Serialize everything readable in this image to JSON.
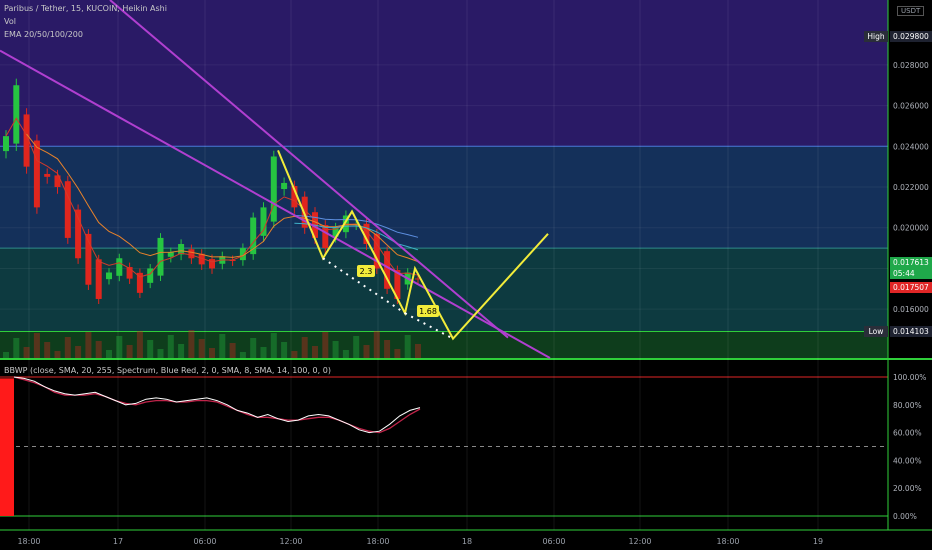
{
  "header": {
    "title": "Paribus / Tether, 15, KUCOIN, Heikin Ashi",
    "vol_label": "Vol",
    "ema_label": "EMA 20/50/100/200",
    "indicator_label": "BBWP (close, SMA, 20, 255, Spectrum, Blue Red, 2, 0, SMA, 8, SMA, 14, 100, 0, 0)"
  },
  "currency": "USDT",
  "high": {
    "label": "High",
    "value": "0.029800"
  },
  "low": {
    "label": "Low",
    "value": "0.014103"
  },
  "price_tags": {
    "last": "0.017613",
    "countdown": "05:44",
    "bid": "0.017507"
  },
  "pattern_labels": {
    "a": "2.3",
    "b": "1.68"
  },
  "colors": {
    "bull": "#26c441",
    "bear": "#e0261e",
    "trendline": "#b03fd0",
    "projection": "#f2ec3a",
    "ema_red": "#d23a2a",
    "ema_orange": "#e8822a",
    "ema_teal": "#3fb0c8",
    "ema_blue": "#5d8fe0",
    "bbwp": "#ffffff",
    "bbwp_ma": "#c0244a",
    "zone_purple": "#2a1a66",
    "zone_blue": "#14305a",
    "zone_teal": "#0d3a40",
    "zone_green": "#0e3d1c"
  },
  "chart_data": [
    {
      "type": "candlestick",
      "title": "Paribus / Tether, 15, KUCOIN, Heikin Ashi",
      "y_ticks": [
        "0.028000",
        "0.026000",
        "0.024000",
        "0.022000",
        "0.020000",
        "0.018000",
        "0.016000"
      ],
      "ylim": [
        0.0136,
        0.0305
      ],
      "x_ticks": [
        "18:00",
        "17",
        "06:00",
        "12:00",
        "18:00",
        "18",
        "06:00",
        "12:00",
        "18:00",
        "19"
      ],
      "high": 0.0298,
      "low": 0.014103,
      "last": 0.017613,
      "bid": 0.017507,
      "series_close": [
        0.0245,
        0.027,
        0.023,
        0.021,
        0.0225,
        0.022,
        0.0195,
        0.0185,
        0.0172,
        0.0165,
        0.0178,
        0.0185,
        0.0175,
        0.0168,
        0.018,
        0.0195,
        0.0188,
        0.0192,
        0.0185,
        0.0182,
        0.018,
        0.0186,
        0.0184,
        0.019,
        0.0205,
        0.021,
        0.0235,
        0.0222,
        0.021,
        0.02,
        0.0195,
        0.019,
        0.02,
        0.0206,
        0.0202,
        0.0192,
        0.018,
        0.017,
        0.0165,
        0.0178,
        0.0175
      ],
      "zones": [
        {
          "from": 0.024,
          "to": 0.0305,
          "color": "purple"
        },
        {
          "from": 0.019,
          "to": 0.024,
          "color": "blue"
        },
        {
          "from": 0.0149,
          "to": 0.019,
          "color": "teal"
        },
        {
          "from": 0.0136,
          "to": 0.0149,
          "color": "green"
        }
      ]
    },
    {
      "type": "line",
      "title": "BBWP",
      "y_ticks": [
        "100.00%",
        "80.00%",
        "60.00%",
        "40.00%",
        "20.00%",
        "0.00%"
      ],
      "ylim": [
        0,
        100
      ],
      "bbwp": [
        100,
        99,
        97,
        93,
        90,
        88,
        87,
        88,
        89,
        86,
        83,
        80,
        81,
        84,
        85,
        84,
        82,
        83,
        84,
        85,
        83,
        80,
        76,
        74,
        71,
        73,
        70,
        68,
        69,
        72,
        73,
        72,
        69,
        66,
        62,
        60,
        61,
        66,
        72,
        76,
        78
      ],
      "bbwp_ma": [
        100,
        98,
        96,
        93,
        89,
        87,
        87,
        87,
        88,
        86,
        83,
        81,
        80,
        82,
        83,
        83,
        82,
        82,
        83,
        83,
        82,
        79,
        76,
        73,
        71,
        71,
        70,
        69,
        69,
        70,
        71,
        71,
        69,
        66,
        63,
        61,
        60,
        63,
        68,
        73,
        77
      ]
    }
  ]
}
